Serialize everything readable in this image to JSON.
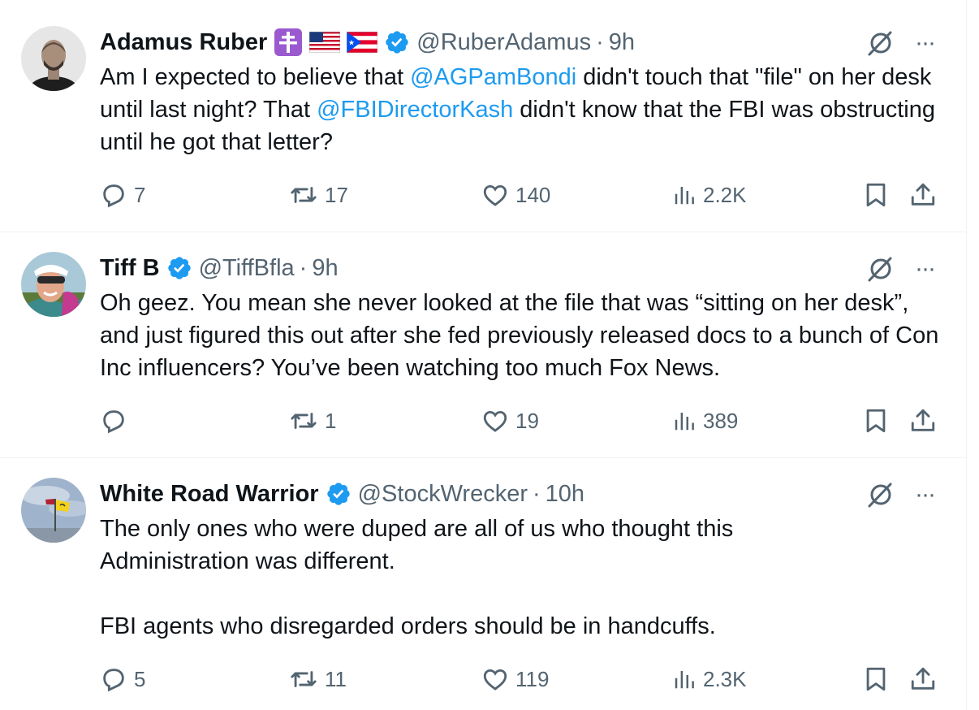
{
  "tweets": [
    {
      "name": "Adamus Ruber",
      "handle": "@RuberAdamus",
      "separator": "·",
      "time": "9h",
      "badges": [
        "patriarchal-cross-emoji",
        "us-flag-emoji",
        "puerto-rico-flag-emoji",
        "verified-badge"
      ],
      "text_parts": [
        {
          "t": "Am I expected to believe that "
        },
        {
          "t": "@AGPamBondi",
          "mention": true
        },
        {
          "t": " didn't touch that \"file\" on her desk until last night? That "
        },
        {
          "t": "@FBIDirectorKash",
          "mention": true
        },
        {
          "t": " didn't know that the FBI was obstructing until he got that letter?"
        }
      ],
      "replies": "7",
      "reposts": "17",
      "likes": "140",
      "views": "2.2K"
    },
    {
      "name": "Tiff B",
      "handle": "@TiffBfla",
      "separator": "·",
      "time": "9h",
      "badges": [
        "verified-badge"
      ],
      "text_parts": [
        {
          "t": "Oh geez.  You mean she never looked at the file that was “sitting on her desk”, and just figured this out after she fed previously released docs to a bunch of Con Inc influencers?  You’ve been watching too much Fox News."
        }
      ],
      "replies": "",
      "reposts": "1",
      "likes": "19",
      "views": "389"
    },
    {
      "name": "White Road Warrior",
      "handle": "@StockWrecker",
      "separator": "·",
      "time": "10h",
      "badges": [
        "verified-badge"
      ],
      "paragraphs": [
        "The only ones who were duped are all of us who thought this Administration was different.",
        "FBI agents who disregarded orders should be in handcuffs."
      ],
      "replies": "5",
      "reposts": "11",
      "likes": "119",
      "views": "2.3K"
    }
  ],
  "more_label": "···",
  "colors": {
    "mention": "#1d9bf0",
    "verified": "#1d9bf0",
    "secondary_text": "#536471",
    "primary_text": "#0f1419",
    "divider": "#eff3f4"
  },
  "icons": {
    "reply": "reply-icon",
    "repost": "repost-icon",
    "like": "like-icon",
    "views": "views-icon",
    "bookmark": "bookmark-icon",
    "share": "share-icon",
    "grok": "grok-icon",
    "more": "more-icon"
  }
}
